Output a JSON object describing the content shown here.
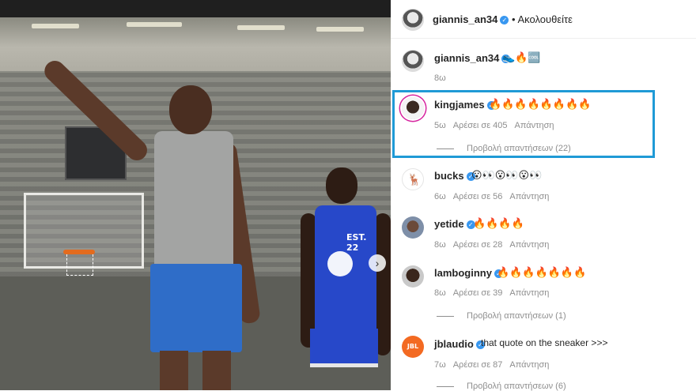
{
  "header": {
    "username": "giannis_an34",
    "follow_label": "• Ακολουθείτε"
  },
  "caption": {
    "username": "giannis_an34",
    "text": "👟🔥🆒",
    "time": "8ω"
  },
  "comments": [
    {
      "username": "kingjames",
      "text": "🔥🔥🔥🔥🔥🔥🔥🔥",
      "time": "5ω",
      "likes": "Αρέσει σε 405",
      "reply": "Απάντηση",
      "replies": "Προβολή απαντήσεων (22)",
      "highlighted": true
    },
    {
      "username": "bucks",
      "text": "😮👀😮👀😮👀",
      "time": "6ω",
      "likes": "Αρέσει σε 56",
      "reply": "Απάντηση"
    },
    {
      "username": "yetide",
      "text": "🔥🔥🔥🔥",
      "time": "8ω",
      "likes": "Αρέσει σε 28",
      "reply": "Απάντηση"
    },
    {
      "username": "lamboginny",
      "text": "🔥🔥🔥🔥🔥🔥🔥",
      "time": "8ω",
      "likes": "Αρέσει σε 39",
      "reply": "Απάντηση",
      "replies": "Προβολή απαντήσεων (1)"
    },
    {
      "username": "jblaudio",
      "text": "that quote on the sneaker >>>",
      "time": "7ω",
      "likes": "Αρέσει σε 87",
      "reply": "Απάντηση",
      "replies": "Προβολή απαντήσεων (6)"
    }
  ],
  "photo": {
    "jersey_number": "22",
    "jersey_text": "EST."
  },
  "icons": {
    "verified": "verified-badge-icon",
    "next": "chevron-right-icon"
  },
  "colors": {
    "verified": "#3897f0",
    "highlight": "#1f9ad6",
    "meta": "#8e8e8e"
  }
}
